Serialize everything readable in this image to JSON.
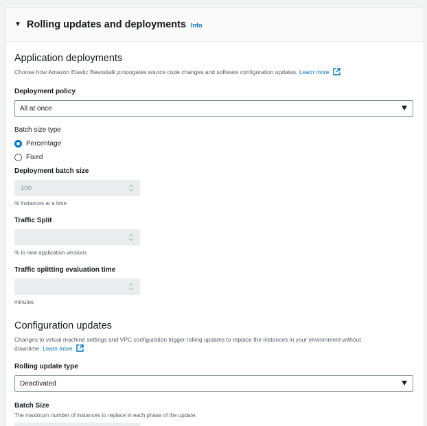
{
  "section": {
    "title": "Rolling updates and deployments",
    "info": "Info"
  },
  "app_deployments": {
    "title": "Application deployments",
    "description": "Choose how Amazon Elastic Beanstalk propogates source code changes and software configuration updates.",
    "learn_more": "Learn more",
    "deployment_policy": {
      "label": "Deployment policy",
      "value": "All at once"
    },
    "batch_size_type": {
      "label": "Batch size type",
      "options": [
        {
          "label": "Percentage",
          "checked": true
        },
        {
          "label": "Fixed",
          "checked": false
        }
      ]
    },
    "batch_size": {
      "label": "Deployment batch size",
      "value": "100",
      "hint": "% instances at a time"
    },
    "traffic_split": {
      "label": "Traffic Split",
      "value": "",
      "hint": "% to new application versions"
    },
    "traffic_eval_time": {
      "label": "Traffic splitting evaluation time",
      "value": "",
      "hint": "minutes"
    }
  },
  "config_updates": {
    "title": "Configuration updates",
    "description_line1": "Changes to virtual machine settings and VPC configuration trigger rolling updates to replace the instances in your environment without",
    "description_line2": "downtime.",
    "learn_more": "Learn more",
    "rolling_update_type": {
      "label": "Rolling update type",
      "value": "Deactivated"
    },
    "batch_size": {
      "label": "Batch Size",
      "description": "The maximum number of instances to replace in each phase of the update."
    }
  },
  "colors": {
    "link": "#0073bb",
    "radio_selected": "#0073bb",
    "disabled_field": "#eaeded"
  },
  "icons": [
    "caret-down-icon",
    "external-link-icon",
    "select-arrow-icon",
    "stepper-icon"
  ]
}
